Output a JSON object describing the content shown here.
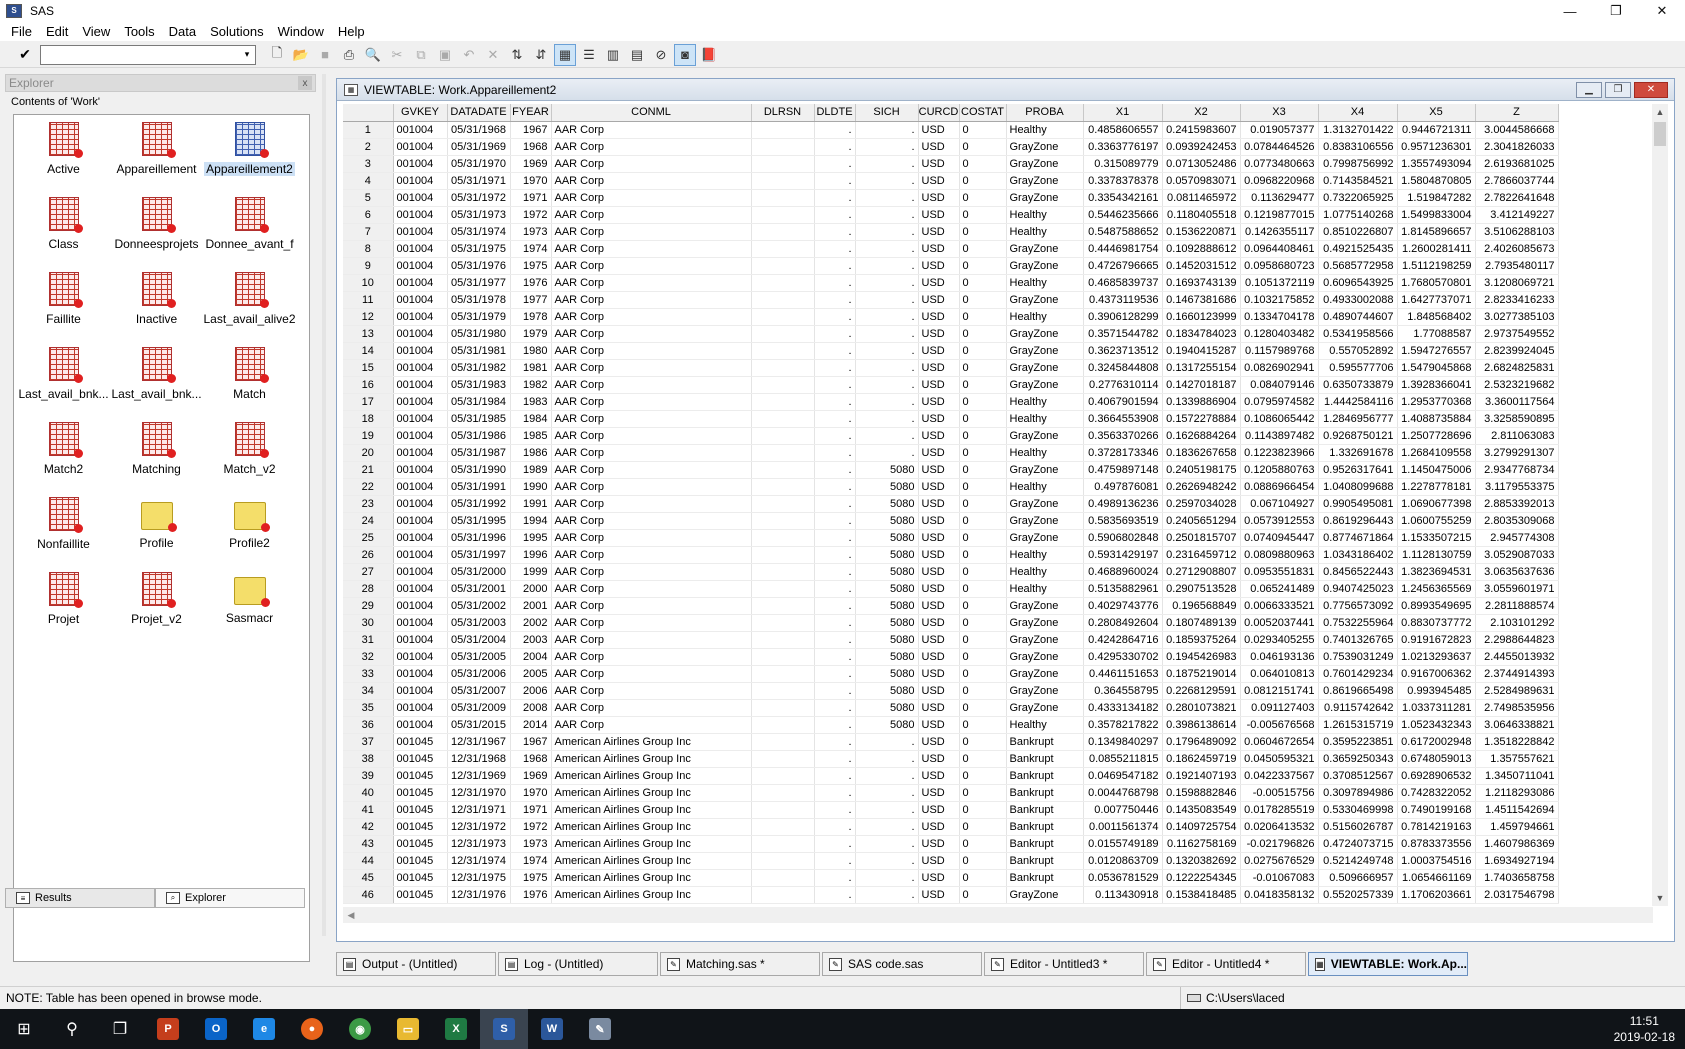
{
  "window": {
    "title": "SAS",
    "min": "—",
    "max": "❐",
    "close": "✕"
  },
  "menu": [
    "File",
    "Edit",
    "View",
    "Tools",
    "Data",
    "Solutions",
    "Window",
    "Help"
  ],
  "toolbar": {
    "command_value": "",
    "check_glyph": "✔",
    "dropdown_glyph": "▾"
  },
  "explorer": {
    "title": "Explorer",
    "close_glyph": "x",
    "contents_label": "Contents of 'Work'",
    "items": [
      {
        "label": "Active",
        "kind": "table"
      },
      {
        "label": "Appareillement",
        "kind": "table"
      },
      {
        "label": "Appareillement2",
        "kind": "table",
        "selected": true
      },
      {
        "label": "Class",
        "kind": "table"
      },
      {
        "label": "Donneesprojets",
        "kind": "table"
      },
      {
        "label": "Donnee_avant_f",
        "kind": "table"
      },
      {
        "label": "Faillite",
        "kind": "table"
      },
      {
        "label": "Inactive",
        "kind": "table"
      },
      {
        "label": "Last_avail_alive2",
        "kind": "table"
      },
      {
        "label": "Last_avail_bnk...",
        "kind": "table"
      },
      {
        "label": "Last_avail_bnk...",
        "kind": "table"
      },
      {
        "label": "Match",
        "kind": "table"
      },
      {
        "label": "Match2",
        "kind": "table"
      },
      {
        "label": "Matching",
        "kind": "table"
      },
      {
        "label": "Match_v2",
        "kind": "table"
      },
      {
        "label": "Nonfaillite",
        "kind": "table"
      },
      {
        "label": "Profile",
        "kind": "folder"
      },
      {
        "label": "Profile2",
        "kind": "folder"
      },
      {
        "label": "Projet",
        "kind": "table"
      },
      {
        "label": "Projet_v2",
        "kind": "table"
      },
      {
        "label": "Sasmacr",
        "kind": "folder"
      }
    ],
    "tabs": [
      "Results",
      "Explorer"
    ]
  },
  "viewtable": {
    "title": "VIEWTABLE: Work.Appareillement2",
    "columns": [
      "",
      "GVKEY",
      "DATADATE",
      "FYEAR",
      "CONML",
      "DLRSN",
      "DLDTE",
      "SICH",
      "CURCD",
      "COSTAT",
      "PROBA",
      "X1",
      "X2",
      "X3",
      "X4",
      "X5",
      "Z"
    ],
    "rows": [
      [
        "1",
        "001004",
        "05/31/1968",
        "1967",
        "AAR Corp",
        "",
        ".",
        ".",
        "USD",
        "0",
        "Healthy",
        "0.4858606557",
        "0.2415983607",
        "0.019057377",
        "1.3132701422",
        "0.9446721311",
        "3.0044586668"
      ],
      [
        "2",
        "001004",
        "05/31/1969",
        "1968",
        "AAR Corp",
        "",
        ".",
        ".",
        "USD",
        "0",
        "GrayZone",
        "0.3363776197",
        "0.0939242453",
        "0.0784464526",
        "0.8383106556",
        "0.9571236301",
        "2.3041826033"
      ],
      [
        "3",
        "001004",
        "05/31/1970",
        "1969",
        "AAR Corp",
        "",
        ".",
        ".",
        "USD",
        "0",
        "GrayZone",
        "0.315089779",
        "0.0713052486",
        "0.0773480663",
        "0.7998756992",
        "1.3557493094",
        "2.6193681025"
      ],
      [
        "4",
        "001004",
        "05/31/1971",
        "1970",
        "AAR Corp",
        "",
        ".",
        ".",
        "USD",
        "0",
        "GrayZone",
        "0.3378378378",
        "0.0570983071",
        "0.0968220968",
        "0.7143584521",
        "1.5804870805",
        "2.7866037744"
      ],
      [
        "5",
        "001004",
        "05/31/1972",
        "1971",
        "AAR Corp",
        "",
        ".",
        ".",
        "USD",
        "0",
        "GrayZone",
        "0.3354342161",
        "0.0811465972",
        "0.113629477",
        "0.7322065925",
        "1.519847282",
        "2.7822641648"
      ],
      [
        "6",
        "001004",
        "05/31/1973",
        "1972",
        "AAR Corp",
        "",
        ".",
        ".",
        "USD",
        "0",
        "Healthy",
        "0.5446235666",
        "0.1180405518",
        "0.1219877015",
        "1.0775140268",
        "1.5499833004",
        "3.412149227"
      ],
      [
        "7",
        "001004",
        "05/31/1974",
        "1973",
        "AAR Corp",
        "",
        ".",
        ".",
        "USD",
        "0",
        "Healthy",
        "0.5487588652",
        "0.1536220871",
        "0.1426355117",
        "0.8510226807",
        "1.8145896657",
        "3.5106288103"
      ],
      [
        "8",
        "001004",
        "05/31/1975",
        "1974",
        "AAR Corp",
        "",
        ".",
        ".",
        "USD",
        "0",
        "GrayZone",
        "0.4446981754",
        "0.1092888612",
        "0.0964408461",
        "0.4921525435",
        "1.2600281411",
        "2.4026085673"
      ],
      [
        "9",
        "001004",
        "05/31/1976",
        "1975",
        "AAR Corp",
        "",
        ".",
        ".",
        "USD",
        "0",
        "GrayZone",
        "0.4726796665",
        "0.1452031512",
        "0.0958680723",
        "0.5685772958",
        "1.5112198259",
        "2.7935480117"
      ],
      [
        "10",
        "001004",
        "05/31/1977",
        "1976",
        "AAR Corp",
        "",
        ".",
        ".",
        "USD",
        "0",
        "Healthy",
        "0.4685839737",
        "0.1693743139",
        "0.1051372119",
        "0.6096543925",
        "1.7680570801",
        "3.1208069721"
      ],
      [
        "11",
        "001004",
        "05/31/1978",
        "1977",
        "AAR Corp",
        "",
        ".",
        ".",
        "USD",
        "0",
        "GrayZone",
        "0.4373119536",
        "0.1467381686",
        "0.1032175852",
        "0.4933002088",
        "1.6427737071",
        "2.8233416233"
      ],
      [
        "12",
        "001004",
        "05/31/1979",
        "1978",
        "AAR Corp",
        "",
        ".",
        ".",
        "USD",
        "0",
        "Healthy",
        "0.3906128299",
        "0.1660123999",
        "0.1334704178",
        "0.4890744607",
        "1.848568402",
        "3.0277385103"
      ],
      [
        "13",
        "001004",
        "05/31/1980",
        "1979",
        "AAR Corp",
        "",
        ".",
        ".",
        "USD",
        "0",
        "GrayZone",
        "0.3571544782",
        "0.1834784023",
        "0.1280403482",
        "0.5341958566",
        "1.77088587",
        "2.9737549552"
      ],
      [
        "14",
        "001004",
        "05/31/1981",
        "1980",
        "AAR Corp",
        "",
        ".",
        ".",
        "USD",
        "0",
        "GrayZone",
        "0.3623713512",
        "0.1940415287",
        "0.1157989768",
        "0.557052892",
        "1.5947276557",
        "2.8239924045"
      ],
      [
        "15",
        "001004",
        "05/31/1982",
        "1981",
        "AAR Corp",
        "",
        ".",
        ".",
        "USD",
        "0",
        "GrayZone",
        "0.3245844808",
        "0.1317255154",
        "0.0826902941",
        "0.595577706",
        "1.5479045868",
        "2.6824825831"
      ],
      [
        "16",
        "001004",
        "05/31/1983",
        "1982",
        "AAR Corp",
        "",
        ".",
        ".",
        "USD",
        "0",
        "GrayZone",
        "0.2776310114",
        "0.1427018187",
        "0.084079146",
        "0.6350733879",
        "1.3928366041",
        "2.5323219682"
      ],
      [
        "17",
        "001004",
        "05/31/1984",
        "1983",
        "AAR Corp",
        "",
        ".",
        ".",
        "USD",
        "0",
        "Healthy",
        "0.4067901594",
        "0.1339886904",
        "0.0795974582",
        "1.4442584116",
        "1.2953770368",
        "3.3600117564"
      ],
      [
        "18",
        "001004",
        "05/31/1985",
        "1984",
        "AAR Corp",
        "",
        ".",
        ".",
        "USD",
        "0",
        "Healthy",
        "0.3664553908",
        "0.1572278884",
        "0.1086065442",
        "1.2846956777",
        "1.4088735884",
        "3.3258590895"
      ],
      [
        "19",
        "001004",
        "05/31/1986",
        "1985",
        "AAR Corp",
        "",
        ".",
        ".",
        "USD",
        "0",
        "GrayZone",
        "0.3563370266",
        "0.1626884264",
        "0.1143897482",
        "0.9268750121",
        "1.2507728696",
        "2.811063083"
      ],
      [
        "20",
        "001004",
        "05/31/1987",
        "1986",
        "AAR Corp",
        "",
        ".",
        ".",
        "USD",
        "0",
        "Healthy",
        "0.3728173346",
        "0.1836267658",
        "0.1223823966",
        "1.332691678",
        "1.2684109558",
        "3.2799291307"
      ],
      [
        "21",
        "001004",
        "05/31/1990",
        "1989",
        "AAR Corp",
        "",
        ".",
        "5080",
        "USD",
        "0",
        "GrayZone",
        "0.4759897148",
        "0.2405198175",
        "0.1205880763",
        "0.9526317641",
        "1.1450475006",
        "2.9347768734"
      ],
      [
        "22",
        "001004",
        "05/31/1991",
        "1990",
        "AAR Corp",
        "",
        ".",
        "5080",
        "USD",
        "0",
        "Healthy",
        "0.497876081",
        "0.2626948242",
        "0.0886966454",
        "1.0408099688",
        "1.2278778181",
        "3.1179553375"
      ],
      [
        "23",
        "001004",
        "05/31/1992",
        "1991",
        "AAR Corp",
        "",
        ".",
        "5080",
        "USD",
        "0",
        "GrayZone",
        "0.4989136236",
        "0.2597034028",
        "0.067104927",
        "0.9905495081",
        "1.0690677398",
        "2.8853392013"
      ],
      [
        "24",
        "001004",
        "05/31/1995",
        "1994",
        "AAR Corp",
        "",
        ".",
        "5080",
        "USD",
        "0",
        "GrayZone",
        "0.5835693519",
        "0.2405651294",
        "0.0573912553",
        "0.8619296443",
        "1.0600755259",
        "2.8035309068"
      ],
      [
        "25",
        "001004",
        "05/31/1996",
        "1995",
        "AAR Corp",
        "",
        ".",
        "5080",
        "USD",
        "0",
        "GrayZone",
        "0.5906802848",
        "0.2501815707",
        "0.0740945447",
        "0.8774671864",
        "1.1533507215",
        "2.945774308"
      ],
      [
        "26",
        "001004",
        "05/31/1997",
        "1996",
        "AAR Corp",
        "",
        ".",
        "5080",
        "USD",
        "0",
        "Healthy",
        "0.5931429197",
        "0.2316459712",
        "0.0809880963",
        "1.0343186402",
        "1.1128130759",
        "3.0529087033"
      ],
      [
        "27",
        "001004",
        "05/31/2000",
        "1999",
        "AAR Corp",
        "",
        ".",
        "5080",
        "USD",
        "0",
        "Healthy",
        "0.4688960024",
        "0.2712908807",
        "0.0953551831",
        "0.8456522443",
        "1.3823694531",
        "3.0635637636"
      ],
      [
        "28",
        "001004",
        "05/31/2001",
        "2000",
        "AAR Corp",
        "",
        ".",
        "5080",
        "USD",
        "0",
        "Healthy",
        "0.5135882961",
        "0.2907513528",
        "0.065241489",
        "0.9407425023",
        "1.2456365569",
        "3.0559601971"
      ],
      [
        "29",
        "001004",
        "05/31/2002",
        "2001",
        "AAR Corp",
        "",
        ".",
        "5080",
        "USD",
        "0",
        "GrayZone",
        "0.4029743776",
        "0.196568849",
        "0.0066333521",
        "0.7756573092",
        "0.8993549695",
        "2.2811888574"
      ],
      [
        "30",
        "001004",
        "05/31/2003",
        "2002",
        "AAR Corp",
        "",
        ".",
        "5080",
        "USD",
        "0",
        "GrayZone",
        "0.2808492604",
        "0.1807489139",
        "0.0052037441",
        "0.7532255964",
        "0.8830737772",
        "2.103101292"
      ],
      [
        "31",
        "001004",
        "05/31/2004",
        "2003",
        "AAR Corp",
        "",
        ".",
        "5080",
        "USD",
        "0",
        "GrayZone",
        "0.4242864716",
        "0.1859375264",
        "0.0293405255",
        "0.7401326765",
        "0.9191672823",
        "2.2988644823"
      ],
      [
        "32",
        "001004",
        "05/31/2005",
        "2004",
        "AAR Corp",
        "",
        ".",
        "5080",
        "USD",
        "0",
        "GrayZone",
        "0.4295330702",
        "0.1945426983",
        "0.046193136",
        "0.7539031249",
        "1.0213293637",
        "2.4455013932"
      ],
      [
        "33",
        "001004",
        "05/31/2006",
        "2005",
        "AAR Corp",
        "",
        ".",
        "5080",
        "USD",
        "0",
        "GrayZone",
        "0.4461151653",
        "0.1875219014",
        "0.064010813",
        "0.7601429234",
        "0.9167006362",
        "2.3744914393"
      ],
      [
        "34",
        "001004",
        "05/31/2007",
        "2006",
        "AAR Corp",
        "",
        ".",
        "5080",
        "USD",
        "0",
        "GrayZone",
        "0.364558795",
        "0.2268129591",
        "0.0812151741",
        "0.8619665498",
        "0.993945485",
        "2.5284989631"
      ],
      [
        "35",
        "001004",
        "05/31/2009",
        "2008",
        "AAR Corp",
        "",
        ".",
        "5080",
        "USD",
        "0",
        "GrayZone",
        "0.4333134182",
        "0.2801073821",
        "0.091127403",
        "0.9115742642",
        "1.0337311281",
        "2.7498535956"
      ],
      [
        "36",
        "001004",
        "05/31/2015",
        "2014",
        "AAR Corp",
        "",
        ".",
        "5080",
        "USD",
        "0",
        "Healthy",
        "0.3578217822",
        "0.3986138614",
        "-0.005676568",
        "1.2615315719",
        "1.0523432343",
        "3.0646338821"
      ],
      [
        "37",
        "001045",
        "12/31/1967",
        "1967",
        "American Airlines Group Inc",
        "",
        ".",
        ".",
        "USD",
        "0",
        "Bankrupt",
        "0.1349840297",
        "0.1796489092",
        "0.0604672654",
        "0.3595223851",
        "0.6172002948",
        "1.3518228842"
      ],
      [
        "38",
        "001045",
        "12/31/1968",
        "1968",
        "American Airlines Group Inc",
        "",
        ".",
        ".",
        "USD",
        "0",
        "Bankrupt",
        "0.0855211815",
        "0.1862459719",
        "0.0450595321",
        "0.3659250343",
        "0.6748059013",
        "1.357557621"
      ],
      [
        "39",
        "001045",
        "12/31/1969",
        "1969",
        "American Airlines Group Inc",
        "",
        ".",
        ".",
        "USD",
        "0",
        "Bankrupt",
        "0.0469547182",
        "0.1921407193",
        "0.0422337567",
        "0.3708512567",
        "0.6928906532",
        "1.3450711041"
      ],
      [
        "40",
        "001045",
        "12/31/1970",
        "1970",
        "American Airlines Group Inc",
        "",
        ".",
        ".",
        "USD",
        "0",
        "Bankrupt",
        "0.0044768798",
        "0.1598882846",
        "-0.00515756",
        "0.3097894986",
        "0.7428322052",
        "1.2118293086"
      ],
      [
        "41",
        "001045",
        "12/31/1971",
        "1971",
        "American Airlines Group Inc",
        "",
        ".",
        ".",
        "USD",
        "0",
        "Bankrupt",
        "0.007750446",
        "0.1435083549",
        "0.0178285519",
        "0.5330469998",
        "0.7490199168",
        "1.4511542694"
      ],
      [
        "42",
        "001045",
        "12/31/1972",
        "1972",
        "American Airlines Group Inc",
        "",
        ".",
        ".",
        "USD",
        "0",
        "Bankrupt",
        "0.0011561374",
        "0.1409725754",
        "0.0206413532",
        "0.5156026787",
        "0.7814219163",
        "1.459794661"
      ],
      [
        "43",
        "001045",
        "12/31/1973",
        "1973",
        "American Airlines Group Inc",
        "",
        ".",
        ".",
        "USD",
        "0",
        "Bankrupt",
        "0.0155749189",
        "0.1162758169",
        "-0.021796826",
        "0.4724073715",
        "0.8783373556",
        "1.4607986369"
      ],
      [
        "44",
        "001045",
        "12/31/1974",
        "1974",
        "American Airlines Group Inc",
        "",
        ".",
        ".",
        "USD",
        "0",
        "Bankrupt",
        "0.0120863709",
        "0.1320382692",
        "0.0275676529",
        "0.5214249748",
        "1.0003754516",
        "1.6934927194"
      ],
      [
        "45",
        "001045",
        "12/31/1975",
        "1975",
        "American Airlines Group Inc",
        "",
        ".",
        ".",
        "USD",
        "0",
        "Bankrupt",
        "0.0536781529",
        "0.1222254345",
        "-0.01067083",
        "0.509666957",
        "1.0654661169",
        "1.7403658758"
      ],
      [
        "46",
        "001045",
        "12/31/1976",
        "1976",
        "American Airlines Group Inc",
        "",
        ".",
        ".",
        "USD",
        "0",
        "GrayZone",
        "0.113430918",
        "0.1538418485",
        "0.0418358132",
        "0.5520257339",
        "1.1706203661",
        "2.0317546798"
      ]
    ]
  },
  "window_tabs": [
    "Output - (Untitled)",
    "Log - (Untitled)",
    "Matching.sas *",
    "SAS code.sas",
    "Editor - Untitled3 *",
    "Editor - Untitled4 *",
    "VIEWTABLE: Work.Ap..."
  ],
  "status": {
    "message": "NOTE: Table has been opened in browse mode.",
    "path": "C:\\Users\\laced"
  },
  "taskbar": {
    "time": "11:51",
    "date": "2019-02-18"
  }
}
